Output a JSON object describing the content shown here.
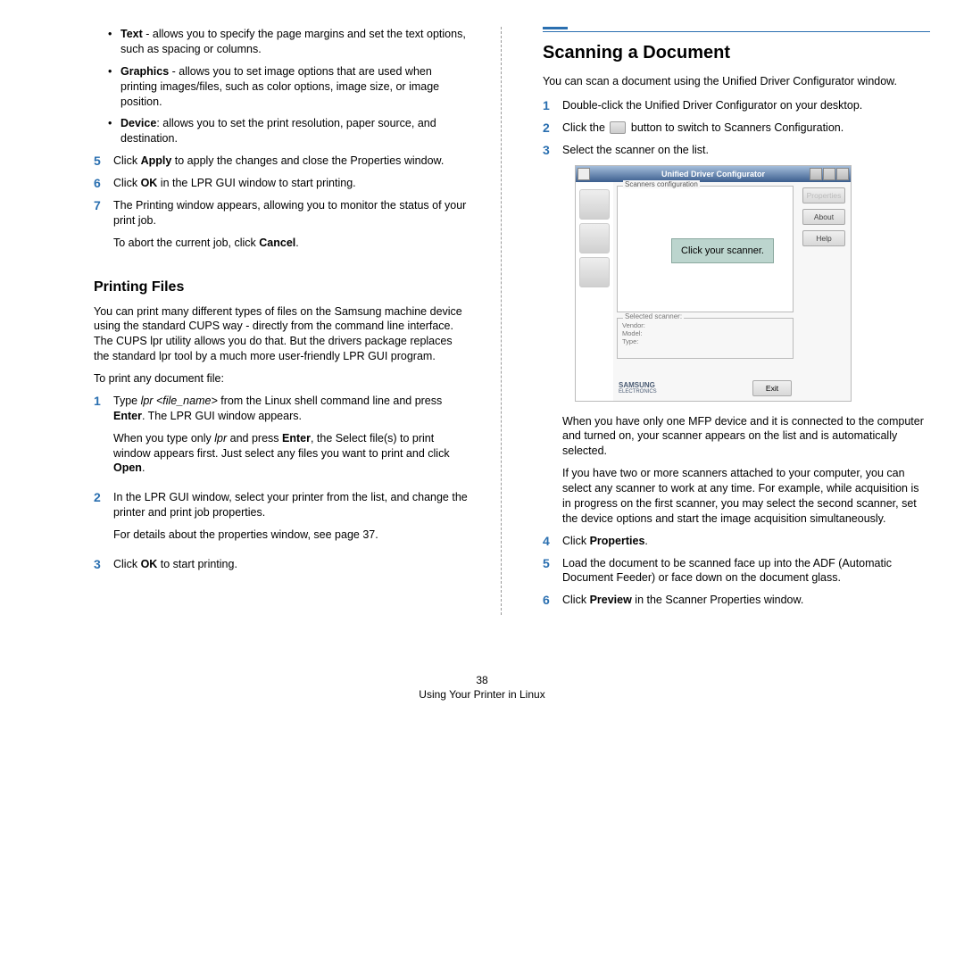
{
  "left": {
    "bullets": [
      {
        "term": "Text",
        "desc": " - allows you to specify the page margins and set the text options, such as spacing or columns."
      },
      {
        "term": "Graphics",
        "desc": " - allows you to set image options that are used when printing images/files, such as color options, image size, or image position."
      },
      {
        "term": "Device",
        "desc": ": allows you to set the print resolution, paper source, and destination."
      }
    ],
    "steps_a": [
      {
        "n": "5",
        "body": [
          {
            "t": "Click ",
            "b": "Apply",
            "a": " to apply the changes and close the Properties window."
          }
        ]
      },
      {
        "n": "6",
        "body": [
          {
            "t": "Click ",
            "b": "OK",
            "a": " in the LPR GUI window to start printing."
          }
        ]
      },
      {
        "n": "7",
        "body": [
          {
            "t": "The Printing window appears, allowing you to monitor the status of your print job."
          }
        ],
        "extra": [
          {
            "t": "To abort the current job, click ",
            "b": "Cancel",
            "a": "."
          }
        ]
      }
    ],
    "subheading": "Printing Files",
    "para1": "You can print many different types of files on the Samsung machine device using the standard CUPS way - directly from the command line interface. The CUPS lpr utility allows you do that. But the drivers package replaces the standard lpr tool by a much more user-friendly LPR GUI program.",
    "para2": "To print any document file:",
    "steps_b": [
      {
        "n": "1",
        "html": "Type <i>lpr &lt;file_name&gt;</i> from the Linux shell command line and press <b>Enter</b>. The LPR GUI window appears.",
        "extra": "When you type only <i>lpr</i> and press <b>Enter</b>, the Select file(s) to print window appears first. Just select any files you want to print and click <b>Open</b>."
      },
      {
        "n": "2",
        "html": "In the LPR GUI window, select your printer from the list, and change the printer and print job properties.",
        "extra": "For details about the properties window, see page 37."
      },
      {
        "n": "3",
        "html": "Click <b>OK</b> to start printing."
      }
    ]
  },
  "right": {
    "heading": "Scanning a Document",
    "intro": "You can scan a document using the Unified Driver Configurator window.",
    "steps": [
      {
        "n": "1",
        "html": "Double-click the Unified Driver Configurator on your desktop."
      },
      {
        "n": "2",
        "html": "Click the <span class=\"scanner-icon\" data-name=\"scanner-icon\" data-interactable=\"false\"></span> button to switch to Scanners Configuration."
      },
      {
        "n": "3",
        "html": "Select the scanner on the list."
      }
    ],
    "screenshot": {
      "title": "Unified Driver Configurator",
      "group_label": "Scanners configuration",
      "callout": "Click your scanner.",
      "selected_label": "Selected scanner:",
      "selected_fields": [
        "Vendor:",
        "Model:",
        "Type:"
      ],
      "btns": [
        "Properties",
        "About",
        "Help"
      ],
      "brand": "SAMSUNG",
      "brand_sub": "ELECTRONICS",
      "exit": "Exit"
    },
    "after_ss": [
      "When you have only one MFP device and it is connected to the computer and turned on, your scanner appears on the list and is automatically selected.",
      "If you have two or more scanners attached to your computer, you can select any scanner to work at any time. For example, while acquisition is in progress on the first scanner, you may select the second scanner, set the device options and start the image acquisition simultaneously."
    ],
    "steps2": [
      {
        "n": "4",
        "html": "Click <b>Properties</b>."
      },
      {
        "n": "5",
        "html": "Load the document to be scanned face up into the ADF (Automatic Document Feeder) or face down on the document glass."
      },
      {
        "n": "6",
        "html": "Click <b>Preview</b> in the Scanner Properties window."
      }
    ]
  },
  "footer": {
    "page": "38",
    "title": "Using Your Printer in Linux"
  }
}
